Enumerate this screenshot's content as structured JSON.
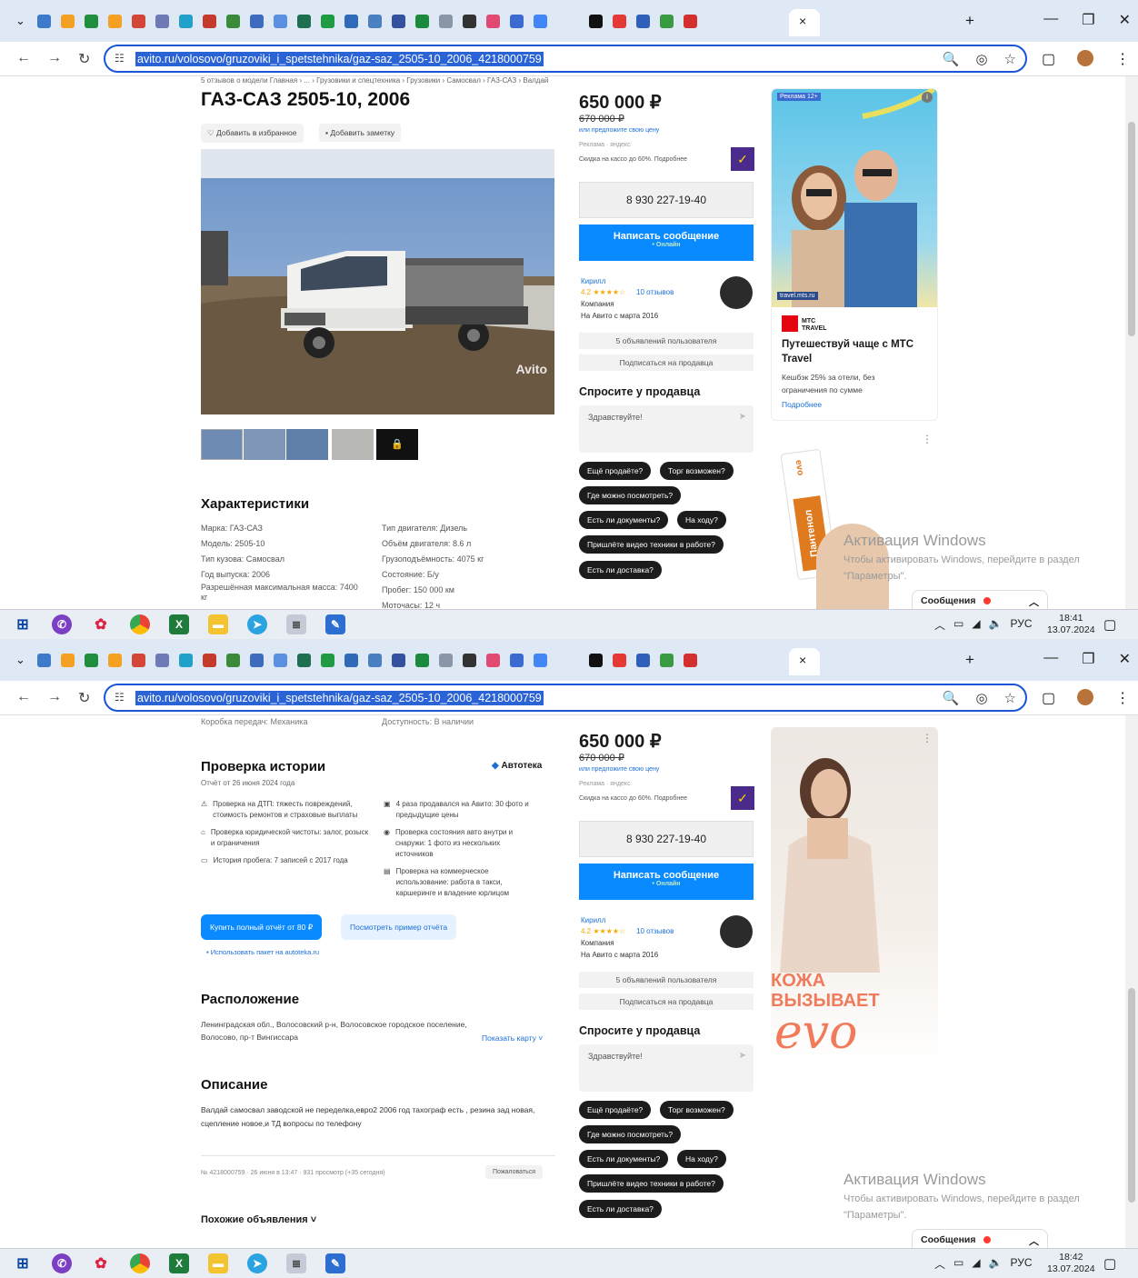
{
  "browser": {
    "url": "avito.ru/volosovo/gruzoviki_i_spetstehnika/gaz-saz_2505-10_2006_4218000759",
    "active_tab_close": "×",
    "new_tab": "+",
    "tab_icon_colors": [
      "#3d7ac9",
      "#f4a023",
      "#1f8f3d",
      "#f4a023",
      "#d44637",
      "#6d7ab5",
      "#21a0c9",
      "#c53a2a",
      "#3a8a3a",
      "#3d6cbf",
      "#5b8fe0",
      "#1e6f4f",
      "#1f9b43",
      "#2f6ab8",
      "#4a7fc1",
      "#3451a0",
      "#1c8a3c",
      "#8a96a8",
      "#333333",
      "#e04a73",
      "#3b6ad0",
      "#4285f4",
      "#111111",
      "#e53935",
      "#2f5fb8",
      "#3a9a44",
      "#d32f2f"
    ]
  },
  "page1": {
    "breadcrumb": "5 отзывов о модели   Главная › ... › Грузовики и спецтехника › Грузовики › Самосвал › ГАЗ-САЗ › Валдай",
    "title": "ГАЗ-САЗ 2505-10, 2006",
    "favorite_btn": "♡ Добавить в избранное",
    "note_btn": "Добавить заметку",
    "photo_watermark": "Avito",
    "characteristics_title": "Характеристики",
    "specs_left": [
      "Марка: ГАЗ-САЗ",
      "Модель: 2505-10",
      "Тип кузова: Самосвал",
      "Год выпуска: 2006",
      "Разрешённая максимальная масса: 7400 кг"
    ],
    "specs_right": [
      "Тип двигателя: Дизель",
      "Объём двигателя: 8.6 л",
      "Грузоподъёмность: 4075 кг",
      "Состояние: Б/у",
      "Пробег: 150 000 км",
      "Моточасы: 12 ч"
    ]
  },
  "page2": {
    "top_specs_left": "Коробка передач: Механика",
    "top_specs_right": "Доступность: В наличии",
    "history_title": "Проверка истории",
    "autoteka": "Автотека",
    "report_date": "Отчёт от 26 июня 2024 года",
    "checks_left": [
      "Проверка на ДТП: тяжесть повреждений, стоимость ремонтов и страховые выплаты",
      "Проверка юридической чистоты: залог, розыск и ограничения",
      "История пробега: 7 записей с 2017 года"
    ],
    "checks_right": [
      "4 раза продавался на Авито: 30 фото и предыдущие цены",
      "Проверка состояния авто внутри и снаружи: 1 фото из нескольких источников",
      "Проверка на коммерческое использование: работа в такси, каршеринге и владение юрлицом"
    ],
    "buy_report": "Купить полный отчёт от 80 ₽",
    "sample_report": "Посмотреть пример отчёта",
    "autoteka_link": "Использовать пакет на autoteka.ru",
    "location_title": "Расположение",
    "address": "Ленинградская обл., Волосовский р-н, Волосовское городское поселение, Волосово, пр-т Вингиссара",
    "show_map": "Показать карту ˅",
    "description_title": "Описание",
    "description": "Валдай самосвал заводской не переделка,евро2 2006 год тахограф есть , резина зад новая, сцепление новое,и ТД вопросы по телефону",
    "meta": "№ 4218000759 · 26 июня в 13:47 · 931 просмотр (+35 сегодня)",
    "complain": "Пожаловаться",
    "similar": "Похожие объявления ˅"
  },
  "sidebar": {
    "price": "650 000 ₽",
    "old_price": "670 000 ₽",
    "offer_price": "или предложите свою цену",
    "ad_label": "Реклама · яндекс",
    "discount": "Скидка на кассо до 60%. Подробнее",
    "phone": "8 930 227-19-40",
    "write": "Написать сообщение",
    "online": "• Онлайн",
    "seller_name": "Кирилл",
    "rating": "4.2 ★★★★☆",
    "reviews": "10 отзывов",
    "seller_type": "Компания",
    "since": "На Авито с марта 2016",
    "seller_ads": "5 объявлений пользователя",
    "subscribe": "Подписаться на продавца",
    "ask_title": "Спросите у продавца",
    "ask_placeholder": "Здравствуйте!",
    "chips": [
      "Ещё продаёте?",
      "Торг возможен?",
      "Где можно посмотреть?",
      "Есть ли документы?",
      "На ходу?",
      "Пришлёте видео техники в работе?",
      "Есть ли доставка?"
    ]
  },
  "ads": {
    "ad1_badge": "Реклама 12+",
    "ad1_site": "travel.mts.ru",
    "ad1_brand": "МТС TRAVEL",
    "ad1_title": "Путешествуй чаще с МТС Travel",
    "ad1_text": "Кешбэк 25% за отели, без ограничения по сумме",
    "ad1_more": "Подробнее",
    "ad2_product": "Пантенол",
    "ad2_brand": "evo",
    "ad3_slogan": "КОЖА ВЫЗЫВАЕТ",
    "ad3_brand": "evo"
  },
  "windows": {
    "activation_title": "Активация Windows",
    "activation_text": "Чтобы активировать Windows, перейдите в раздел \"Параметры\".",
    "messages": "Сообщения",
    "tray_lang": "РУС",
    "time1": "18:41",
    "time2": "18:42",
    "date": "13.07.2024"
  }
}
